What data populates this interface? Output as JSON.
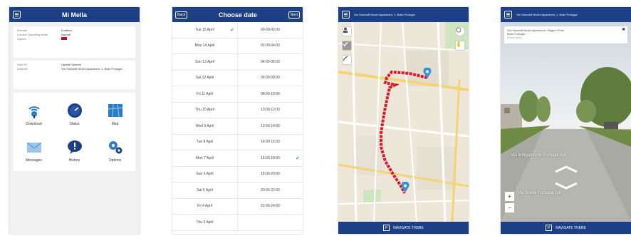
{
  "screen1": {
    "title": "Mi Mella",
    "status_rows": [
      {
        "key": "Remote",
        "value": "Enabled"
      },
      {
        "key": "Current Operating Mode",
        "value": "Normal"
      },
      {
        "key": "Uptime",
        "value": ""
      }
    ],
    "address_rows": [
      {
        "key": "Last Fix",
        "value": "Update Options"
      },
      {
        "key": "Address",
        "value": "Via Tolomelli Ninchi Apartment, 1, Bollo Portugal"
      }
    ],
    "tiles": [
      {
        "label": "Download",
        "icon": "satellite-signal-icon"
      },
      {
        "label": "Status",
        "icon": "gauge-icon"
      },
      {
        "label": "Map",
        "icon": "map-icon"
      },
      {
        "label": "Messages",
        "icon": "envelope-icon"
      },
      {
        "label": "History",
        "icon": "speech-bubble-icon"
      },
      {
        "label": "Options",
        "icon": "gears-icon"
      }
    ]
  },
  "screen2": {
    "title": "Choose date",
    "back_label": "Back",
    "next_label": "Next",
    "dates": [
      "Tue 15 April",
      "Mon 14 April",
      "Sun 13 April",
      "Sat 12 April",
      "Fri 11 April",
      "Thu 10 April",
      "Wed 9 April",
      "Tue 8 April",
      "Mon 7 April",
      "Sun 6 April",
      "Sat 5 April",
      "Fri 4 April",
      "Thu 3 April"
    ],
    "times": [
      "00:00-02:00",
      "02:00-04:00",
      "04:00-06:00",
      "06:00-08:00",
      "08:00-10:00",
      "10:00-12:00",
      "12:00-14:00",
      "14:00-16:00",
      "16:00-18:00",
      "18:00-20:00",
      "20:00-22:00",
      "22:00-24:00"
    ],
    "selected_date_index": 0,
    "selected_time_index": 8
  },
  "screen3": {
    "header_text": "Via Tolomelli Ninchi Apartment, 1, Bollo Portugal",
    "footer_label": "NAVIGATE THERE",
    "route_color": "#d81b2c"
  },
  "screen4": {
    "header_text": "Via Tolomelli Ninchi Apartment, 1, Bollo Portugal",
    "card_line1": "Via Tolomelli Ninchi Apartment, Viagem Porto",
    "card_line2": "Bollo Portugal",
    "card_line3": "Street View",
    "street_label_1": "Via Antigamente Portugal Apt",
    "street_label_2": "Via Nome Portugal Apt",
    "footer_label": "NAVIGATE THERE"
  },
  "colors": {
    "header_blue": "#1c3f86",
    "accent_blue": "#3a8fd9",
    "route_red": "#d81b2c"
  }
}
